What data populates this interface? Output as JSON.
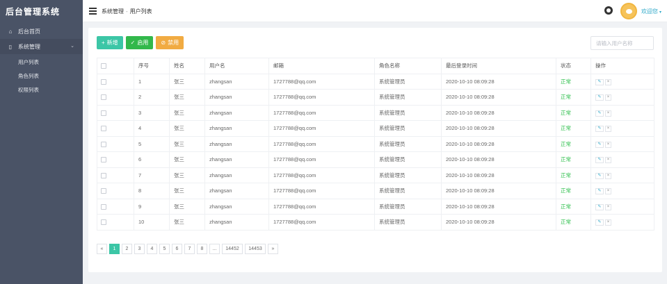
{
  "sidebar": {
    "title": "后台管理系统",
    "items": [
      {
        "label": "后台首页",
        "icon": "home-icon"
      },
      {
        "label": "系统管理",
        "icon": "file-icon"
      }
    ],
    "subitems": [
      "用户列表",
      "角色列表",
      "权限列表"
    ]
  },
  "header": {
    "breadcrumb": [
      "系统管理",
      "用户列表"
    ],
    "username": "欢迎您"
  },
  "toolbar": {
    "add_label": "新增",
    "enable_label": "启用",
    "disable_label": "禁用",
    "search_placeholder": "请输入用户名称"
  },
  "table": {
    "columns": [
      "",
      "序号",
      "姓名",
      "用户名",
      "邮箱",
      "角色名称",
      "最后登录时间",
      "状态",
      "操作"
    ],
    "rows": [
      {
        "id": "1",
        "name": "张三",
        "username": "zhangsan",
        "email": "1727788@qq.com",
        "role": "系统管理员",
        "last_login": "2020-10-10 08:09:28",
        "status": "正常"
      },
      {
        "id": "2",
        "name": "张三",
        "username": "zhangsan",
        "email": "1727788@qq.com",
        "role": "系统管理员",
        "last_login": "2020-10-10 08:09:28",
        "status": "正常"
      },
      {
        "id": "3",
        "name": "张三",
        "username": "zhangsan",
        "email": "1727788@qq.com",
        "role": "系统管理员",
        "last_login": "2020-10-10 08:09:28",
        "status": "正常"
      },
      {
        "id": "4",
        "name": "张三",
        "username": "zhangsan",
        "email": "1727788@qq.com",
        "role": "系统管理员",
        "last_login": "2020-10-10 08:09:28",
        "status": "正常"
      },
      {
        "id": "5",
        "name": "张三",
        "username": "zhangsan",
        "email": "1727788@qq.com",
        "role": "系统管理员",
        "last_login": "2020-10-10 08:09:28",
        "status": "正常"
      },
      {
        "id": "6",
        "name": "张三",
        "username": "zhangsan",
        "email": "1727788@qq.com",
        "role": "系统管理员",
        "last_login": "2020-10-10 08:09:28",
        "status": "正常"
      },
      {
        "id": "7",
        "name": "张三",
        "username": "zhangsan",
        "email": "1727788@qq.com",
        "role": "系统管理员",
        "last_login": "2020-10-10 08:09:28",
        "status": "正常"
      },
      {
        "id": "8",
        "name": "张三",
        "username": "zhangsan",
        "email": "1727788@qq.com",
        "role": "系统管理员",
        "last_login": "2020-10-10 08:09:28",
        "status": "正常"
      },
      {
        "id": "9",
        "name": "张三",
        "username": "zhangsan",
        "email": "1727788@qq.com",
        "role": "系统管理员",
        "last_login": "2020-10-10 08:09:28",
        "status": "正常"
      },
      {
        "id": "10",
        "name": "张三",
        "username": "zhangsan",
        "email": "1727788@qq.com",
        "role": "系统管理员",
        "last_login": "2020-10-10 08:09:28",
        "status": "正常"
      }
    ]
  },
  "pagination": {
    "prev": "«",
    "pages": [
      "1",
      "2",
      "3",
      "4",
      "5",
      "6",
      "7",
      "8",
      "...",
      "14452",
      "14453"
    ],
    "next": "»",
    "active": "1"
  },
  "colors": {
    "sidebar_bg": "#4a5366",
    "accent": "#3cc6a6",
    "enable": "#32b84b",
    "disable": "#f1ab42",
    "status_ok": "#2cbf4b"
  }
}
